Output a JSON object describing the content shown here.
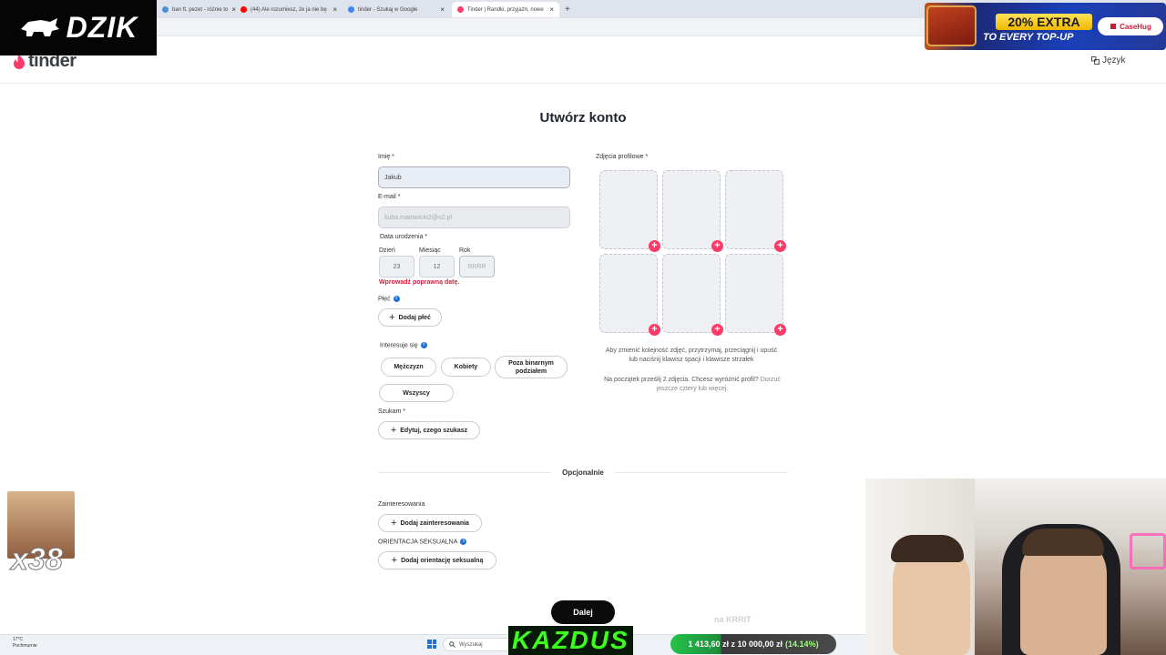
{
  "browser": {
    "tabs": [
      {
        "label": "ban ft. pezet - różnie to",
        "active": false,
        "fav_color": "#4a90d9"
      },
      {
        "label": "(44) Ale rozumiesz, że ja nie bę",
        "active": false,
        "fav_color": "#ff0000"
      },
      {
        "label": "tinder - Szukaj w Google",
        "active": false,
        "fav_color": "#4285f4"
      },
      {
        "label": "Tinder | Randki, przyjaźń, nowe",
        "active": true,
        "fav_color": "#fd3a68"
      }
    ],
    "new_tab": "+"
  },
  "tinder": {
    "logo": "tinder",
    "language": "Język",
    "title": "Utwórz konto",
    "brand_color": "#fd3a68",
    "form": {
      "name_label": "Imię *",
      "name_value": "Jakub",
      "email_label": "E-mail *",
      "email_value": "kuba.matowicki2@o2.pl",
      "dob_label": "Data urodzenia *",
      "day_label": "Dzień",
      "month_label": "Miesiąc",
      "year_label": "Rok",
      "day_value": "23",
      "month_value": "12",
      "year_placeholder": "RRRR",
      "error": "Wprowadź poprawną datę.",
      "gender_label": "Płeć",
      "add_gender": "Dodaj płeć",
      "interested_label": "Interesuje się",
      "options": [
        "Mężczyzn",
        "Kobiety",
        "Poza binarnym podziałem",
        "Wszyscy"
      ],
      "looking_label": "Szukam *",
      "edit_looking": "Edytuj, czego szukasz",
      "optional": "Opcjonalnie",
      "interests_label": "Zainteresowania",
      "add_interests": "Dodaj zainteresowania",
      "orientation_label": "ORIENTACJA SEKSUALNA",
      "add_orientation": "Dodaj orientację seksualną",
      "next": "Dalej"
    },
    "photos": {
      "label": "Zdjęcia profilowe *",
      "count": 6,
      "hint1": "Aby zmienić kolejność zdjęć, przytrzymaj, przeciągnij i upuść lub naciśnij klawisz spacji i klawisze strzałek",
      "hint2a": "Na początek prześlij 2 zdjęcia. Chcesz wyróżnić profil?",
      "hint2b": "Dorzuć jeszcze cztery lub więcej."
    }
  },
  "taskbar": {
    "weather_temp": "17°C",
    "weather_desc": "Pochmurnie",
    "search": "Wyszukaj"
  },
  "overlays": {
    "stream_logo": "DZIK",
    "promo_line1": "20% EXTRA",
    "promo_line2": "TO EVERY TOP-UP",
    "promo_brand": "CaseHug",
    "emote_count": "x38",
    "channel": "KAZDUS",
    "bet_current": "1 413,60 zł",
    "bet_separator": "z",
    "bet_goal": "10 000,00 zł",
    "bet_pct": "(14.14%)",
    "watermark": "na KRRIT"
  }
}
